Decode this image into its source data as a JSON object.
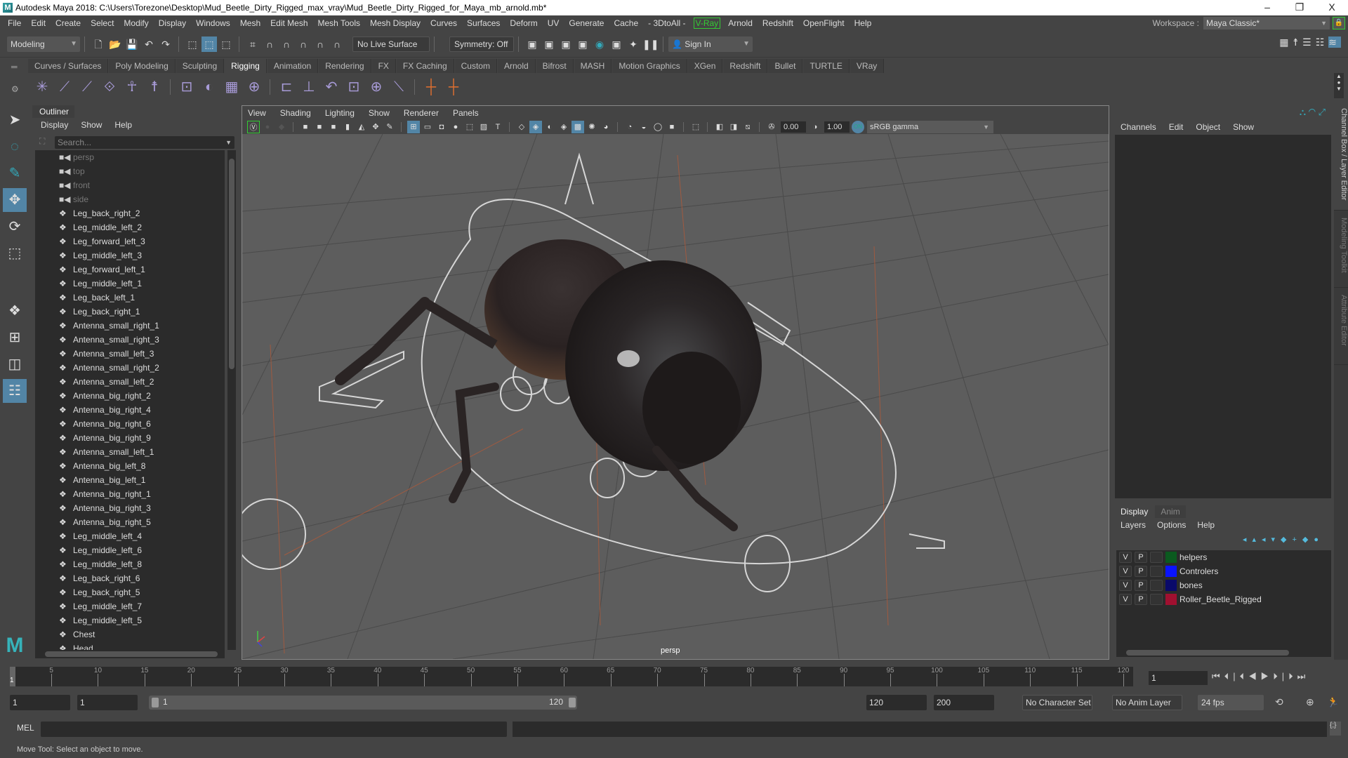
{
  "window": {
    "title": "Autodesk Maya 2018: C:\\Users\\Torezone\\Desktop\\Mud_Beetle_Dirty_Rigged_max_vray\\Mud_Beetle_Dirty_Rigged_for_Maya_mb_arnold.mb*",
    "controls": {
      "minimize": "–",
      "restore": "❐",
      "close": "X"
    }
  },
  "menubar": {
    "items": [
      "File",
      "Edit",
      "Create",
      "Select",
      "Modify",
      "Display",
      "Windows",
      "Mesh",
      "Edit Mesh",
      "Mesh Tools",
      "Mesh Display",
      "Curves",
      "Surfaces",
      "Deform",
      "UV",
      "Generate",
      "Cache",
      "- 3DtoAll -"
    ],
    "vray": "V-Ray",
    "items_after": [
      "Arnold",
      "Redshift",
      "OpenFlight",
      "Help"
    ],
    "workspace_label": "Workspace :",
    "workspace_value": "Maya Classic*"
  },
  "statusline": {
    "mode": "Modeling",
    "live_surface": "No Live Surface",
    "symmetry": "Symmetry: Off",
    "sign_in": "Sign In"
  },
  "shelf": {
    "tabs": [
      "Curves / Surfaces",
      "Poly Modeling",
      "Sculpting",
      "Rigging",
      "Animation",
      "Rendering",
      "FX",
      "FX Caching",
      "Custom",
      "Arnold",
      "Bifrost",
      "MASH",
      "Motion Graphics",
      "XGen",
      "Redshift",
      "Bullet",
      "TURTLE",
      "VRay"
    ],
    "active_tab": "Rigging",
    "icons": [
      "joint-tool",
      "ik-handle",
      "ik-spline",
      "insert-joint",
      "humanik",
      "quick-rig",
      "skin-bind",
      "paint-weights",
      "lattice",
      "cluster",
      "parent-constraint",
      "point-constraint",
      "orient-constraint",
      "scale-constraint",
      "aim-constraint",
      "pole-vector",
      "locator",
      "locator-edit"
    ]
  },
  "outliner": {
    "title": "Outliner",
    "menu": [
      "Display",
      "Show",
      "Help"
    ],
    "search_placeholder": "Search...",
    "items": [
      {
        "name": "persp",
        "type": "camera"
      },
      {
        "name": "top",
        "type": "camera"
      },
      {
        "name": "front",
        "type": "camera"
      },
      {
        "name": "side",
        "type": "camera"
      },
      {
        "name": "Leg_back_right_2",
        "type": "group"
      },
      {
        "name": "Leg_middle_left_2",
        "type": "group"
      },
      {
        "name": "Leg_forward_left_3",
        "type": "group"
      },
      {
        "name": "Leg_middle_left_3",
        "type": "group"
      },
      {
        "name": "Leg_forward_left_1",
        "type": "group"
      },
      {
        "name": "Leg_middle_left_1",
        "type": "group"
      },
      {
        "name": "Leg_back_left_1",
        "type": "group"
      },
      {
        "name": "Leg_back_right_1",
        "type": "group"
      },
      {
        "name": "Antenna_small_right_1",
        "type": "group"
      },
      {
        "name": "Antenna_small_right_3",
        "type": "group"
      },
      {
        "name": "Antenna_small_left_3",
        "type": "group"
      },
      {
        "name": "Antenna_small_right_2",
        "type": "group"
      },
      {
        "name": "Antenna_small_left_2",
        "type": "group"
      },
      {
        "name": "Antenna_big_right_2",
        "type": "group"
      },
      {
        "name": "Antenna_big_right_4",
        "type": "group"
      },
      {
        "name": "Antenna_big_right_6",
        "type": "group"
      },
      {
        "name": "Antenna_big_right_9",
        "type": "group"
      },
      {
        "name": "Antenna_small_left_1",
        "type": "group"
      },
      {
        "name": "Antenna_big_left_8",
        "type": "group"
      },
      {
        "name": "Antenna_big_left_1",
        "type": "group"
      },
      {
        "name": "Antenna_big_right_1",
        "type": "group"
      },
      {
        "name": "Antenna_big_right_3",
        "type": "group"
      },
      {
        "name": "Antenna_big_right_5",
        "type": "group"
      },
      {
        "name": "Leg_middle_left_4",
        "type": "group"
      },
      {
        "name": "Leg_middle_left_6",
        "type": "group"
      },
      {
        "name": "Leg_middle_left_8",
        "type": "group"
      },
      {
        "name": "Leg_back_right_6",
        "type": "group"
      },
      {
        "name": "Leg_back_right_5",
        "type": "group"
      },
      {
        "name": "Leg_middle_left_7",
        "type": "group"
      },
      {
        "name": "Leg_middle_left_5",
        "type": "group"
      },
      {
        "name": "Chest",
        "type": "group"
      },
      {
        "name": "Head",
        "type": "group"
      }
    ]
  },
  "viewport": {
    "menu": [
      "View",
      "Shading",
      "Lighting",
      "Show",
      "Renderer",
      "Panels"
    ],
    "exposure": "0.00",
    "gamma": "1.00",
    "color_management_on": "ON",
    "color_space": "sRGB gamma",
    "camera_label": "persp"
  },
  "channelbox": {
    "menu": [
      "Channels",
      "Edit",
      "Object",
      "Show"
    ],
    "side_tabs": [
      "Channel Box / Layer Editor",
      "Modeling Toolkit",
      "Attribute Editor"
    ]
  },
  "layers": {
    "tabs": [
      "Display",
      "Anim"
    ],
    "active_tab": "Display",
    "menu": [
      "Layers",
      "Options",
      "Help"
    ],
    "rows": [
      {
        "v": "V",
        "p": "P",
        "name": "helpers",
        "color": "#0b5a1f"
      },
      {
        "v": "V",
        "p": "P",
        "name": "Controlers",
        "color": "#0a14ff"
      },
      {
        "v": "V",
        "p": "P",
        "name": "bones",
        "color": "#0a0a6a"
      },
      {
        "v": "V",
        "p": "P",
        "name": "Roller_Beetle_Rigged",
        "color": "#a01030"
      }
    ]
  },
  "timeline": {
    "ticks": [
      5,
      10,
      15,
      20,
      25,
      30,
      35,
      40,
      45,
      50,
      55,
      60,
      65,
      70,
      75,
      80,
      85,
      90,
      95,
      100,
      105,
      110,
      115,
      120
    ],
    "start": 1,
    "end": 120,
    "current_marker": "1",
    "current_frame": "1"
  },
  "range": {
    "start": "1",
    "anim_start": "1",
    "slider_start": "1",
    "slider_end": "120",
    "playback_end": "120",
    "anim_end": "200",
    "character_set": "No Character Set",
    "anim_layer": "No Anim Layer",
    "fps": "24 fps"
  },
  "cmdline": {
    "label": "MEL"
  },
  "helpline": {
    "text": "Move Tool: Select an object to move."
  }
}
